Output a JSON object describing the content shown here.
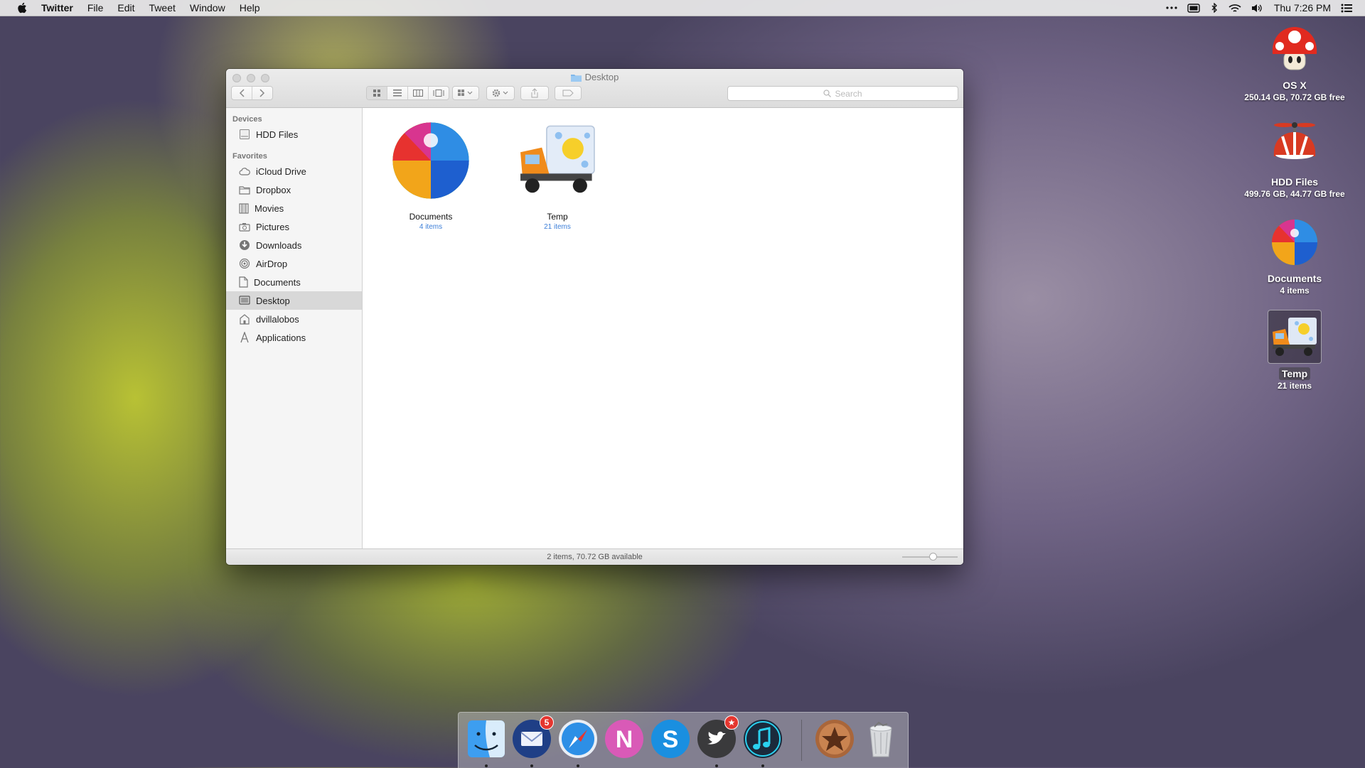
{
  "menubar": {
    "app_name": "Twitter",
    "menus": [
      "File",
      "Edit",
      "Tweet",
      "Window",
      "Help"
    ],
    "clock": "Thu 7:26 PM",
    "status_icons": [
      "more-icon",
      "battery-icon",
      "bluetooth-icon",
      "wifi-icon",
      "volume-icon",
      "notification-list-icon"
    ]
  },
  "desktop": {
    "icons": [
      {
        "title": "OS X",
        "sub": "250.14 GB, 70.72 GB free",
        "icon": "mushroom-drive-icon"
      },
      {
        "title": "HDD Files",
        "sub": "499.76 GB, 44.77 GB free",
        "icon": "propeller-drive-icon"
      },
      {
        "title": "Documents",
        "sub": "4 items",
        "icon": "beach-ball-folder-icon"
      },
      {
        "title": "Temp",
        "sub": "21 items",
        "icon": "truck-folder-icon"
      }
    ]
  },
  "finder": {
    "title": "Desktop",
    "search_placeholder": "Search",
    "sidebar": {
      "devices_header": "Devices",
      "devices": [
        {
          "label": "HDD Files",
          "icon": "drive-icon"
        }
      ],
      "favorites_header": "Favorites",
      "favorites": [
        {
          "label": "iCloud Drive",
          "icon": "cloud-icon"
        },
        {
          "label": "Dropbox",
          "icon": "folder-icon"
        },
        {
          "label": "Movies",
          "icon": "film-icon"
        },
        {
          "label": "Pictures",
          "icon": "camera-icon"
        },
        {
          "label": "Downloads",
          "icon": "download-icon"
        },
        {
          "label": "AirDrop",
          "icon": "airdrop-icon"
        },
        {
          "label": "Documents",
          "icon": "document-icon"
        },
        {
          "label": "Desktop",
          "icon": "desktop-icon"
        },
        {
          "label": "dvillalobos",
          "icon": "home-icon"
        },
        {
          "label": "Applications",
          "icon": "applications-icon"
        }
      ],
      "selected": "Desktop"
    },
    "items": [
      {
        "name": "Documents",
        "sub": "4 items"
      },
      {
        "name": "Temp",
        "sub": "21 items"
      }
    ],
    "status": "2 items, 70.72 GB available"
  },
  "dock": {
    "apps": [
      {
        "name": "Finder",
        "icon": "finder-icon",
        "running": true
      },
      {
        "name": "Mail",
        "icon": "mail-icon",
        "running": true,
        "badge": "5"
      },
      {
        "name": "Safari",
        "icon": "safari-icon",
        "running": true
      },
      {
        "name": "N",
        "icon": "n-app-icon",
        "running": false
      },
      {
        "name": "Skype",
        "icon": "skype-icon",
        "running": false
      },
      {
        "name": "Twitter",
        "icon": "twitter-icon",
        "running": true
      },
      {
        "name": "Music",
        "icon": "music-icon",
        "running": true
      },
      {
        "name": "Favorites",
        "icon": "star-icon",
        "running": false
      },
      {
        "name": "Trash",
        "icon": "trash-icon",
        "running": false
      }
    ],
    "letters": {
      "n": "N",
      "s": "S"
    }
  },
  "colors": {
    "accent": "#3d7fd8",
    "badge": "#e5362f"
  }
}
